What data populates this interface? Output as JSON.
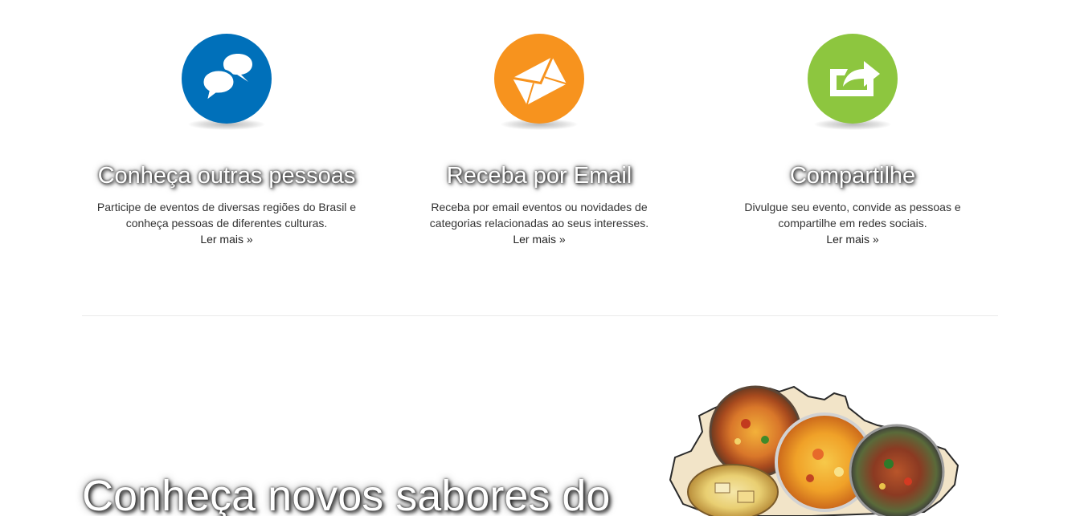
{
  "colors": {
    "blue": "#0070BA",
    "orange": "#F7931E",
    "green": "#8DC63F"
  },
  "features": [
    {
      "icon": "chat-bubbles-icon",
      "title": "Conheça outras pessoas",
      "text_line1": "Participe de eventos de diversas regiões do Brasil e",
      "text_line2": "conheça pessoas de diferentes culturas.",
      "link": "Ler mais »"
    },
    {
      "icon": "envelope-icon",
      "title": "Receba por Email",
      "text_line1": "Receba por email eventos ou novidades de",
      "text_line2": "categorias relacionadas ao seus interesses.",
      "link": "Ler mais »"
    },
    {
      "icon": "share-icon",
      "title": "Compartilhe",
      "text_line1": "Divulgue seu evento, convide as pessoas e",
      "text_line2": "compartilhe em redes sociais.",
      "link": "Ler mais »"
    }
  ],
  "hero": {
    "title": "Conheça novos sabores do"
  }
}
